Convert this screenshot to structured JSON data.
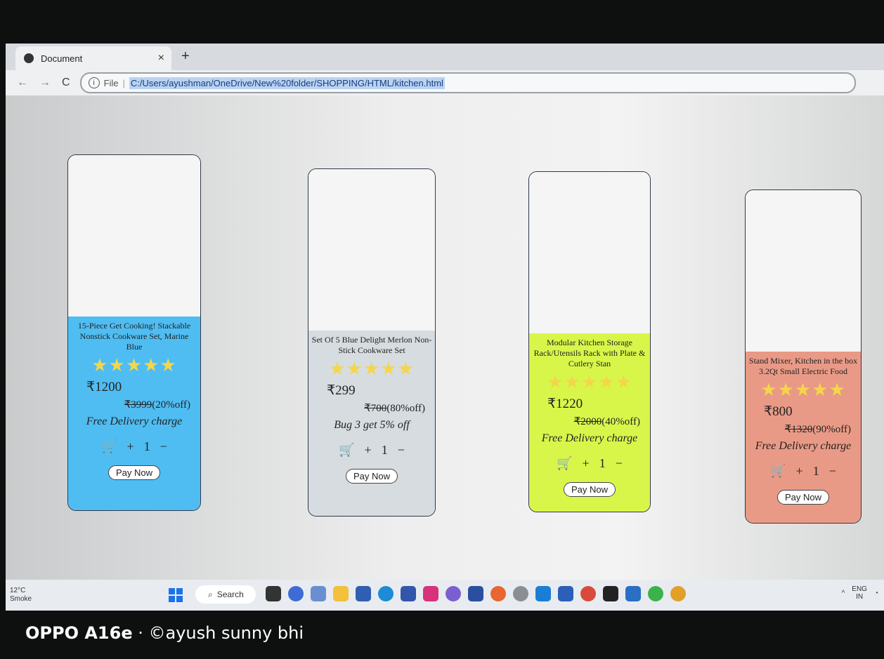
{
  "browser": {
    "tab_title": "Document",
    "tab_close": "×",
    "new_tab": "+",
    "back": "←",
    "forward": "→",
    "reload": "C",
    "info": "i",
    "file_label": "File",
    "separator": "|",
    "url": "C:/Users/ayushman/OneDrive/New%20folder/SHOPPING/HTML/kitchen.html"
  },
  "products": [
    {
      "name": "15-Piece Get Cooking! Stackable Nonstick Cookware Set, Marine Blue",
      "stars_text": "★★★★★",
      "rating": 4.5,
      "price": "₹1200",
      "mrp": "₹3999",
      "discount": "(20%off)",
      "offer": "Free Delivery charge",
      "cart_icon": "🛒",
      "plus": "+",
      "qty": "1",
      "minus": "−",
      "pay_label": "Pay Now",
      "color": "#4fbdf2"
    },
    {
      "name": "Set Of 5 Blue Delight Merlon Non-Stick Cookware Set",
      "stars_text": "★★★★★",
      "rating": 4.5,
      "price": "₹299",
      "mrp": "₹700",
      "discount": "(80%off)",
      "offer": "Bug 3 get 5% off",
      "cart_icon": "🛒",
      "plus": "+",
      "qty": "1",
      "minus": "−",
      "pay_label": "Pay Now",
      "color": "#d6dcdf"
    },
    {
      "name": "Modular Kitchen Storage Rack/Utensils Rack with Plate & Cutlery Stan",
      "stars_text": "★★★★★",
      "rating": 4.5,
      "price": "₹1220",
      "mrp": "₹2000",
      "discount": "(40%off)",
      "offer": "Free Delivery charge",
      "cart_icon": "🛒",
      "plus": "+",
      "qty": "1",
      "minus": "−",
      "pay_label": "Pay Now",
      "color": "#d8f64a"
    },
    {
      "name": "Stand Mixer, Kitchen in the box 3.2Qt Small Electric Food",
      "stars_text": "★★★★★",
      "rating": 4.5,
      "price": "₹800",
      "mrp": "₹1320",
      "discount": "(90%off)",
      "offer": "Free Delivery charge",
      "cart_icon": "🛒",
      "plus": "+",
      "qty": "1",
      "minus": "−",
      "pay_label": "Pay Now",
      "color": "#e99a86"
    }
  ],
  "taskbar": {
    "temp": "12°C",
    "condition": "Smoke",
    "search_label": "Search",
    "lang": "ENG",
    "region": "IN"
  },
  "watermark": {
    "device": "OPPO A16e",
    "credit": " · ©ayush sunny bhi"
  }
}
